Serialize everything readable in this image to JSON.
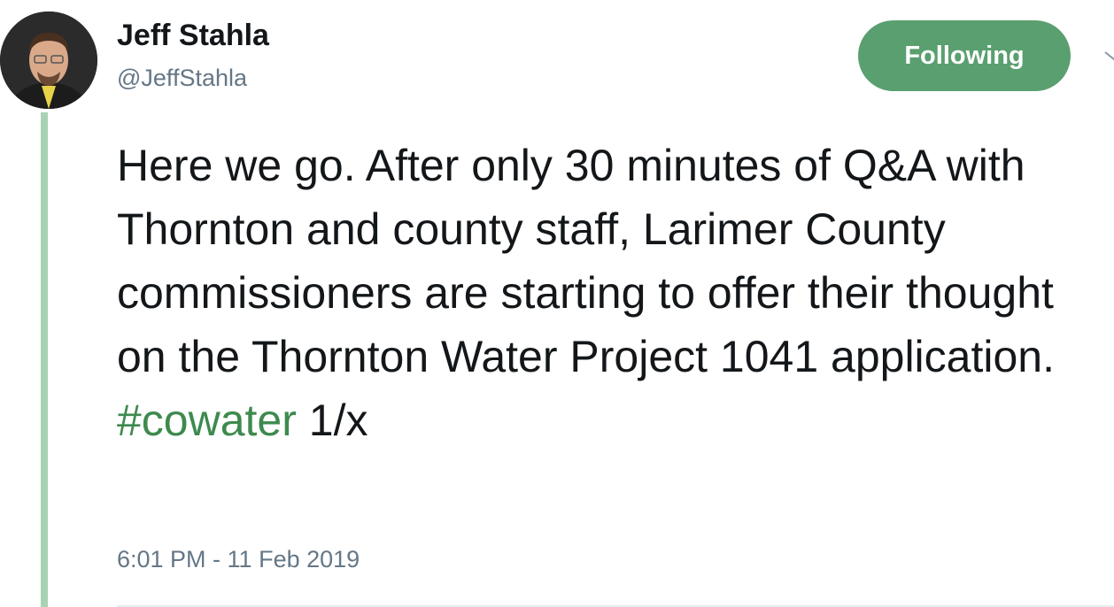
{
  "author": {
    "display_name": "Jeff Stahla",
    "handle": "@JeffStahla"
  },
  "follow_button": {
    "label": "Following",
    "color": "#5a9f6f"
  },
  "tweet": {
    "text_before_hashtag": "Here we go. After only 30 minutes of Q&A with Thornton and county staff, Larimer County commissioners are starting to offer their thought on the Thornton Water Project 1041 application. ",
    "hashtag": "#cowater",
    "text_after_hashtag": " 1/x",
    "timestamp": "6:01 PM - 11 Feb 2019"
  },
  "colors": {
    "thread_line": "#a7d3b2",
    "hashtag": "#3d8a4e",
    "secondary_text": "#657786"
  },
  "icons": {
    "avatar": "profile-photo",
    "menu": "chevron-down-icon"
  }
}
